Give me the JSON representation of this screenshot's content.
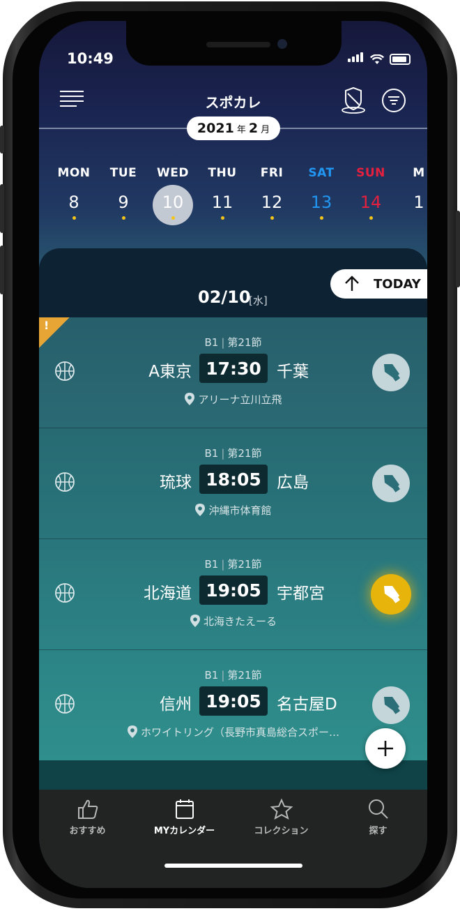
{
  "status_bar": {
    "time": "10:49"
  },
  "header": {
    "title": "スポカレ"
  },
  "date_pill": {
    "year": "2021",
    "year_unit": "年",
    "month": "2",
    "month_unit": "月"
  },
  "week": [
    {
      "name": "MON",
      "date": "8",
      "color": "#ffffff"
    },
    {
      "name": "TUE",
      "date": "9",
      "color": "#ffffff"
    },
    {
      "name": "WED",
      "date": "10",
      "color": "#ffffff",
      "selected": true
    },
    {
      "name": "THU",
      "date": "11",
      "color": "#ffffff"
    },
    {
      "name": "FRI",
      "date": "12",
      "color": "#ffffff"
    },
    {
      "name": "SAT",
      "date": "13",
      "color": "#2196f3"
    },
    {
      "name": "SUN",
      "date": "14",
      "color": "#e5203f"
    },
    {
      "name": "M",
      "date": "1",
      "color": "#ffffff"
    }
  ],
  "day_header": {
    "date": "02/10",
    "weekday": "[水]",
    "today_label": "TODAY"
  },
  "games": [
    {
      "league": "B1",
      "round": "第21節",
      "home": "A東京",
      "time": "17:30",
      "away": "千葉",
      "venue": "アリーナ立川立飛",
      "favorite": false,
      "alert": "!"
    },
    {
      "league": "B1",
      "round": "第21節",
      "home": "琉球",
      "time": "18:05",
      "away": "広島",
      "venue": "沖縄市体育館",
      "favorite": false
    },
    {
      "league": "B1",
      "round": "第21節",
      "home": "北海道",
      "time": "19:05",
      "away": "宇都宮",
      "venue": "北海きたえーる",
      "favorite": true
    },
    {
      "league": "B1",
      "round": "第21節",
      "home": "信州",
      "time": "19:05",
      "away": "名古屋D",
      "venue": "ホワイトリング（長野市真島総合スポー…",
      "favorite": false
    }
  ],
  "tabs": [
    {
      "label": "おすすめ",
      "icon": "thumbs-up-icon"
    },
    {
      "label": "MYカレンダー",
      "icon": "calendar-icon",
      "active": true
    },
    {
      "label": "コレクション",
      "icon": "star-icon"
    },
    {
      "label": "探す",
      "icon": "search-icon"
    }
  ],
  "colors": {
    "accent_favorite": "#e7b40c",
    "saturday": "#2196f3",
    "sunday": "#e5203f",
    "event_dot": "#f5c518"
  }
}
